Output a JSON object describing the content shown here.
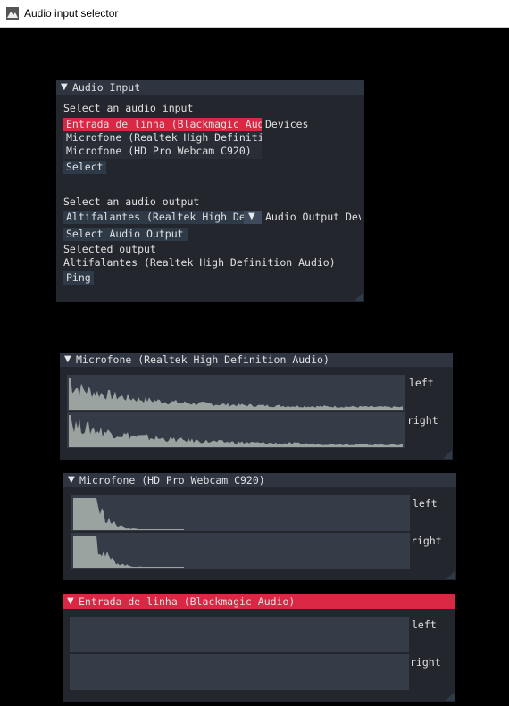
{
  "titlebar": {
    "title": "Audio input selector",
    "icon": "app-icon"
  },
  "audio_input_window": {
    "title": "Audio Input",
    "select_input_label": "Select an audio input",
    "inputs": [
      "Entrada de linha (Blackmagic Audio)",
      "Microfone (Realtek High Definition Audio)",
      "Microfone (HD Pro Webcam C920)"
    ],
    "selected_input_index": 0,
    "devices_label": "Devices",
    "select_button": "Select",
    "select_output_label": "Select an audio output",
    "output_combo_value": "Altifalantes (Realtek High Definition Audio)",
    "output_devices_label": "Audio Output Devices",
    "select_output_button": "Select Audio Output",
    "selected_output_label": "Selected output",
    "selected_output_value": "Altifalantes (Realtek High Definition Audio)",
    "ping_button": "Ping"
  },
  "meters": [
    {
      "title": "Microfone (Realtek High Definition Audio)",
      "active": false,
      "channels": [
        "left",
        "right"
      ],
      "profile": "wide"
    },
    {
      "title": "Microfone (HD Pro Webcam C920)",
      "active": false,
      "channels": [
        "left",
        "right"
      ],
      "profile": "narrow"
    },
    {
      "title": "Entrada de linha (Blackmagic Audio)",
      "active": true,
      "channels": [
        "left",
        "right"
      ],
      "profile": "empty"
    }
  ],
  "colors": {
    "window_bg": "#24262d",
    "header": "#2e3440",
    "active_header": "#d92744",
    "selection": "#d92744",
    "plot_bg": "#353b47",
    "plot_fill": "#9aa39f"
  }
}
